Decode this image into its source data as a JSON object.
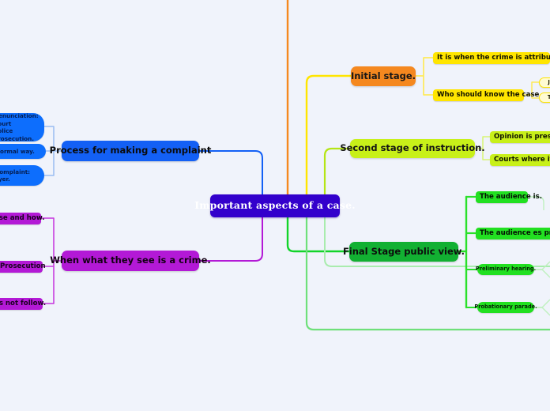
{
  "diagram": {
    "type": "mind-map",
    "background_color": "#f0f3fb",
    "root": {
      "label": "Important aspects of a case.",
      "color": "#3300cc"
    },
    "branches": [
      {
        "id": "process-complaint",
        "label": "Process for making a complaint",
        "color": "#1360f5",
        "side": "left",
        "children": [
          {
            "label": "Denunciation:\nCourt\nPolice\nProsecution.",
            "color": "#0d6efd"
          },
          {
            "label": "a informal way.",
            "color": "#0d6efd"
          },
          {
            "label": "or complaint:\nlawyer.",
            "color": "#0d6efd"
          }
        ]
      },
      {
        "id": "when-crime",
        "label": "When what they see is a crime.",
        "color": "#b319d6",
        "side": "left",
        "children": [
          {
            "label": "ase and how.",
            "color": "#b319d6"
          },
          {
            "label": "Prosecution",
            "color": "#b319d6"
          },
          {
            "label": "es not follow.",
            "color": "#b319d6"
          }
        ]
      },
      {
        "id": "initial-stage",
        "label": "Initial stage.",
        "color": "#f5881f",
        "side": "right",
        "children": [
          {
            "label": "It is when the crime is attributed.",
            "color": "#ffe500",
            "children": []
          },
          {
            "label": "Who should know the case.",
            "color": "#ffe500",
            "children": [
              {
                "label": "Ju",
                "color": "#fffbd2"
              },
              {
                "label": "To",
                "color": "#fffbd2"
              }
            ]
          }
        ]
      },
      {
        "id": "second-stage",
        "label": "Second stage of instruction.",
        "color": "#c8f019",
        "side": "right",
        "children": [
          {
            "label": "Opinion is presen",
            "color": "#c8f019"
          },
          {
            "label": "Courts where it ta",
            "color": "#c8f019"
          }
        ]
      },
      {
        "id": "final-stage",
        "label": "Final Stage public view.",
        "color": "#12b032",
        "side": "right",
        "children": [
          {
            "label": "The audience is.",
            "color": "#22e021"
          },
          {
            "label": "The audience es private",
            "color": "#22e021"
          },
          {
            "label": "Preliminary hearing.",
            "color": "#22e021"
          },
          {
            "label": "Probationary parade.",
            "color": "#22e021"
          }
        ]
      }
    ]
  }
}
